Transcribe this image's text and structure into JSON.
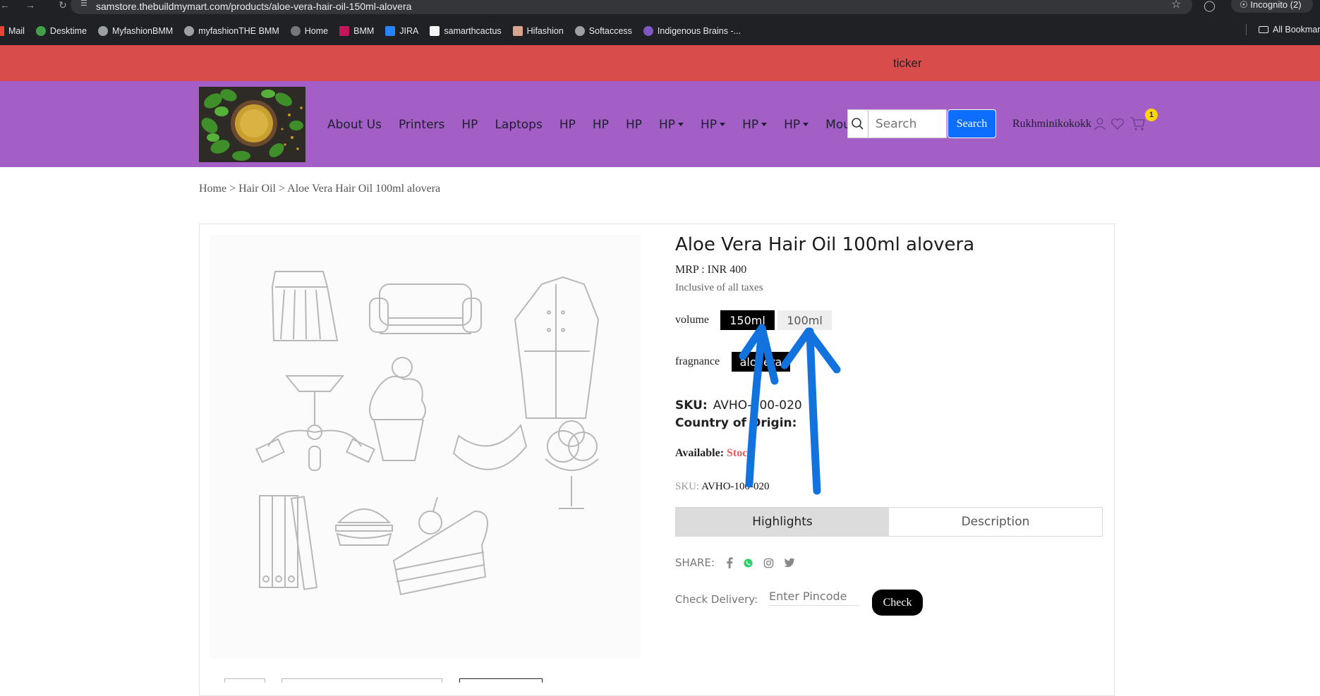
{
  "browser": {
    "url": "samstore.thebuildmymart.com/products/aloe-vera-hair-oil-150ml-alovera",
    "incognito_label": "Incognito (2)",
    "bookmarks": [
      "Mail",
      "Desktime",
      "MyfashionBMM",
      "myfashionTHE BMM",
      "Home",
      "BMM",
      "JIRA",
      "samarthcactus",
      "Hifashion",
      "Softaccess",
      "Indigenous Brains -..."
    ],
    "all_bookmarks": "All Bookmarks"
  },
  "ticker": {
    "text": "ticker"
  },
  "header": {
    "nav": [
      "About Us",
      "Printers",
      "HP",
      "Laptops",
      "HP",
      "HP",
      "HP",
      "HP",
      "HP",
      "HP",
      "HP",
      "Mouse"
    ],
    "search_placeholder": "Search",
    "search_button": "Search",
    "username": "Rukhminikokokk",
    "cart_count": "1",
    "colors": {
      "ticker": "#d94c4c",
      "header": "#a35fc6",
      "search_button": "#0d6efd"
    }
  },
  "breadcrumb": "Home > Hair Oil > Aloe Vera Hair Oil 100ml alovera",
  "product": {
    "title": "Aloe Vera Hair Oil 100ml alovera",
    "mrp": "MRP :  INR 400",
    "tax_note": "Inclusive of all taxes",
    "volume_label": "volume",
    "volume_options": [
      "150ml",
      "100ml"
    ],
    "volume_selected": "150ml",
    "fragrance_label": "fragnance",
    "fragrance_options": [
      "alovera"
    ],
    "sku_label": "SKU:",
    "sku_value": "AVHO-100-020",
    "country_label": "Country of Origin:",
    "available_label": "Available:",
    "available_value": "Stock",
    "sku2_label": "SKU:",
    "sku2_value": "AVHO-100-020",
    "tabs": [
      "Highlights",
      "Description"
    ],
    "share_label": "SHARE:",
    "share_icons": [
      "facebook-icon",
      "whatsapp-icon",
      "instagram-icon",
      "twitter-icon"
    ],
    "delivery_label": "Check Delivery:",
    "pincode_placeholder": "Enter Pincode",
    "check_button": "Check"
  }
}
